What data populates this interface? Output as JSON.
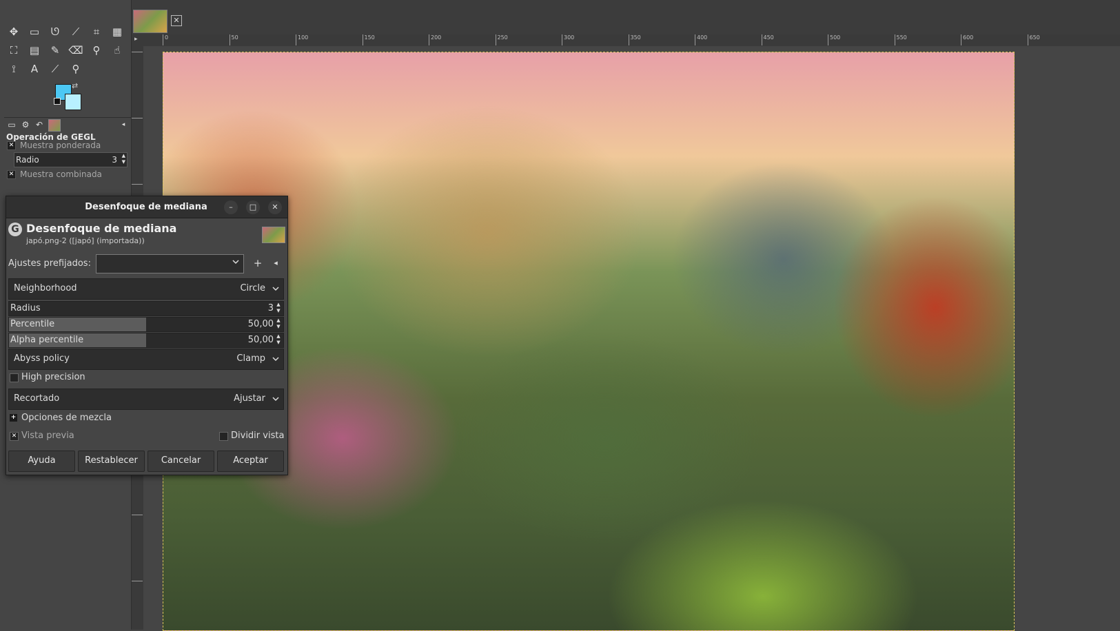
{
  "toolbox": {
    "tools": [
      {
        "name": "move-icon",
        "glyph": "✥"
      },
      {
        "name": "rect-select-icon",
        "glyph": "▭"
      },
      {
        "name": "free-select-icon",
        "glyph": "ᘎ"
      },
      {
        "name": "fuzzy-select-icon",
        "glyph": "⟋"
      },
      {
        "name": "crop-icon",
        "glyph": "⌗"
      },
      {
        "name": "unified-transform-icon",
        "glyph": "▦"
      },
      {
        "name": "bucket-fill-icon",
        "glyph": "⛶"
      },
      {
        "name": "gradient-icon",
        "glyph": "▤"
      },
      {
        "name": "paintbrush-icon",
        "glyph": "✎"
      },
      {
        "name": "eraser-icon",
        "glyph": "⌫"
      },
      {
        "name": "clone-icon",
        "glyph": "⚲"
      },
      {
        "name": "smudge-icon",
        "glyph": "☝"
      },
      {
        "name": "paths-icon",
        "glyph": "⟟"
      },
      {
        "name": "text-icon",
        "glyph": "A"
      },
      {
        "name": "color-picker-icon",
        "glyph": "⟋"
      },
      {
        "name": "zoom-icon",
        "glyph": "⚲"
      }
    ],
    "fg_color": "#4cc8f4",
    "bg_color": "#b8f0ff",
    "options_title": "Operación de GEGL",
    "weighted_sample_label": "Muestra ponderada",
    "radius_label": "Radio",
    "radius_value": "3",
    "merged_sample_label": "Muestra combinada"
  },
  "ruler": {
    "h_ticks": [
      "0",
      "50",
      "100",
      "150",
      "200",
      "250",
      "300",
      "350",
      "400",
      "450",
      "500",
      "550",
      "600",
      "650"
    ]
  },
  "dialog": {
    "window_title": "Desenfoque de mediana",
    "header_title": "Desenfoque de mediana",
    "header_subtitle": "japó.png-2 ([japó] (importada))",
    "presets_label": "Ajustes prefijados:",
    "presets_value": "",
    "neighborhood": {
      "label": "Neighborhood",
      "value": "Circle"
    },
    "radius": {
      "label": "Radius",
      "value": "3"
    },
    "percentile": {
      "label": "Percentile",
      "value": "50,00",
      "fraction": 0.5
    },
    "alpha_percentile": {
      "label": "Alpha percentile",
      "value": "50,00",
      "fraction": 0.5
    },
    "abyss_policy": {
      "label": "Abyss policy",
      "value": "Clamp"
    },
    "high_precision": {
      "label": "High precision",
      "checked": false
    },
    "clipping": {
      "label": "Recortado",
      "value": "Ajustar"
    },
    "blend_options": {
      "label": "Opciones de mezcla"
    },
    "preview": {
      "label": "Vista previa",
      "checked": true
    },
    "split_view": {
      "label": "Dividir vista",
      "checked": false
    },
    "buttons": {
      "help": "Ayuda",
      "reset": "Restablecer",
      "cancel": "Cancelar",
      "ok": "Aceptar"
    }
  }
}
